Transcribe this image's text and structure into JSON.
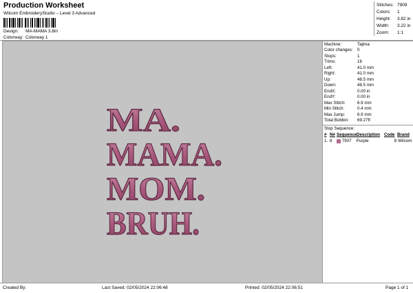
{
  "header": {
    "title": "Production Worksheet",
    "subtitle": "Wilcom EmbroideryStudio – Level 3 Advanced"
  },
  "meta": [
    {
      "label": "Design:",
      "value": "MA-MAMA 3.8in"
    },
    {
      "label": "Colorway:",
      "value": "Colorway 1"
    }
  ],
  "stats": [
    {
      "label": "Stitches:",
      "value": "7909"
    },
    {
      "label": "Colors:",
      "value": "1"
    },
    {
      "label": "Height:",
      "value": "3.82 in"
    },
    {
      "label": "Width:",
      "value": "3.22 in"
    },
    {
      "label": "Zoom:",
      "value": "1:1"
    }
  ],
  "design_text": [
    "MA.",
    "MAMA.",
    "MOM.",
    "BRUH."
  ],
  "colors": {
    "thread": "#b06a8c",
    "thread_dark": "#6b2f4a",
    "canvas": "#c4c4c4"
  },
  "machine_info": [
    {
      "label": "Machine:",
      "value": "Tajima"
    },
    {
      "label": "Color changes:",
      "value": "0"
    },
    {
      "label": "Stops:",
      "value": "1"
    },
    {
      "label": "Trims:",
      "value": "16"
    },
    {
      "label": "Left:",
      "value": "41.0 mm"
    },
    {
      "label": "Right:",
      "value": "41.0 mm"
    },
    {
      "label": "Up:",
      "value": "48.5 mm"
    },
    {
      "label": "Down:",
      "value": "48.5 mm"
    },
    {
      "label": "EndX:",
      "value": "0.00 in"
    },
    {
      "label": "EndY:",
      "value": "0.00 in"
    },
    {
      "label": "Max Stitch:",
      "value": "6.9 mm"
    },
    {
      "label": "Min Stitch:",
      "value": "0.4 mm"
    },
    {
      "label": "Max Jump:",
      "value": "6.9 mm"
    },
    {
      "label": "Total Bobbin:",
      "value": "69.27ft"
    }
  ],
  "stop_sequence": {
    "title": "Stop Sequence:",
    "headers": [
      "#",
      "N#",
      "Sequence",
      "Description",
      "Code",
      "Brand"
    ],
    "rows": [
      {
        "num": "1.",
        "n": "8",
        "sequence": "7907",
        "description": "Purple",
        "code": "8",
        "brand": "Wilcom"
      }
    ]
  },
  "footer": {
    "created": "Created By:",
    "saved": "Last Saved: 02/05/2024 22:06:48",
    "printed": "Printed: 02/05/2024 22:06:51",
    "page": "Page 1 of 1"
  }
}
